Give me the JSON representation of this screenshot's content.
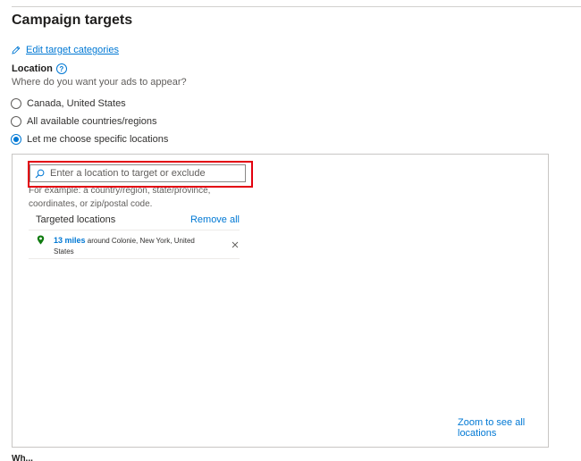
{
  "header": {
    "title": "Campaign targets"
  },
  "edit_link": {
    "label": "Edit target categories",
    "icon": "pencil-icon"
  },
  "location": {
    "label": "Location",
    "help_icon": "?",
    "question": "Where do you want your ads to appear?",
    "options": [
      {
        "label": "Canada, United States",
        "checked": false
      },
      {
        "label": "All available countries/regions",
        "checked": false
      },
      {
        "label": "Let me choose specific locations",
        "checked": true
      }
    ]
  },
  "panel": {
    "search": {
      "placeholder": "Enter a location to target or exclude",
      "value": ""
    },
    "hint": "For example: a country/region, state/province, coordinates, or zip/postal code.",
    "targeted": {
      "title": "Targeted locations",
      "remove_all": "Remove all",
      "items": [
        {
          "radius": "13 miles",
          "description": "around Colonie, New York, United States"
        }
      ]
    },
    "zoom_link": "Zoom to see all locations"
  },
  "next_section": {
    "title": "Wh..."
  },
  "colors": {
    "accent": "#0078d4",
    "highlight": "#e3000f",
    "pin": "#107c10"
  }
}
